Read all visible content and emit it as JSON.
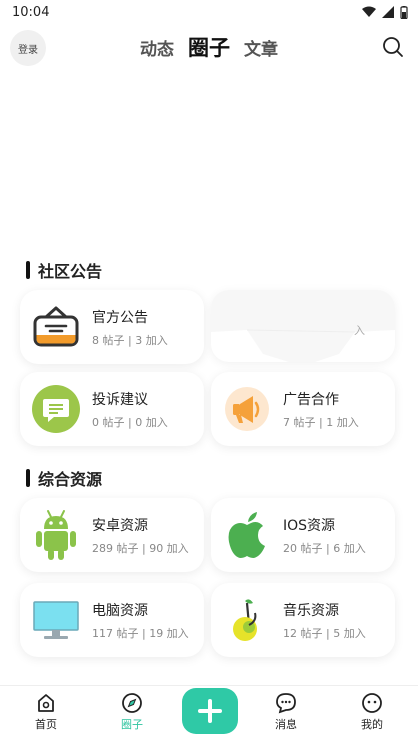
{
  "status": {
    "time": "10:04"
  },
  "header": {
    "login_label": "登录",
    "tabs": [
      {
        "label": "动态",
        "active": false
      },
      {
        "label": "圈子",
        "active": true
      },
      {
        "label": "文章",
        "active": false
      }
    ]
  },
  "sections": [
    {
      "title": "社区公告",
      "cards": [
        {
          "name": "官方公告",
          "meta": "8 帖子 | 3 加入",
          "icon": "announcement-box-icon"
        },
        {
          "name": "",
          "meta": "入",
          "icon": ""
        },
        {
          "name": "投诉建议",
          "meta": "0 帖子 | 0 加入",
          "icon": "feedback-chat-icon"
        },
        {
          "name": "广告合作",
          "meta": "7 帖子 | 1 加入",
          "icon": "megaphone-icon"
        }
      ]
    },
    {
      "title": "综合资源",
      "cards": [
        {
          "name": "安卓资源",
          "meta": "289 帖子 | 90 加入",
          "icon": "android-icon"
        },
        {
          "name": "IOS资源",
          "meta": "20 帖子 | 6 加入",
          "icon": "apple-icon"
        },
        {
          "name": "电脑资源",
          "meta": "117 帖子 | 19 加入",
          "icon": "monitor-icon"
        },
        {
          "name": "音乐资源",
          "meta": "12 帖子 | 5 加入",
          "icon": "music-note-icon"
        }
      ]
    }
  ],
  "bottom_nav": {
    "items": [
      {
        "label": "首页",
        "icon": "home-icon",
        "active": false
      },
      {
        "label": "圈子",
        "icon": "compass-icon",
        "active": true
      },
      {
        "label": "",
        "icon": "plus-icon",
        "active": false
      },
      {
        "label": "消息",
        "icon": "message-icon",
        "active": false
      },
      {
        "label": "我的",
        "icon": "profile-icon",
        "active": false
      }
    ]
  },
  "colors": {
    "accent": "#2fc9a6",
    "android": "#8bc34a",
    "apple": "#4caf50",
    "monitor": "#7be0f0"
  }
}
